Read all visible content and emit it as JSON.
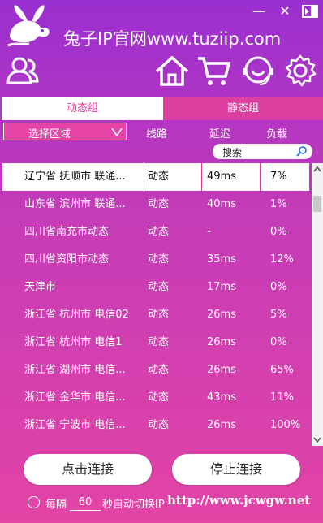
{
  "window": {
    "title": "兔子IP官网www.tuziip.com",
    "minimize_glyph": "—",
    "close_glyph": "✕",
    "pin_icon": "exit-icon"
  },
  "toolbar": {
    "icons": [
      "users-icon",
      "home-icon",
      "cart-icon",
      "support-icon",
      "gear-icon"
    ]
  },
  "tabs": [
    {
      "label": "动态组",
      "active": true
    },
    {
      "label": "静态组",
      "active": false
    }
  ],
  "filter": {
    "region_select": "选择区域",
    "columns": {
      "line": "线路",
      "latency": "延迟",
      "load": "负载"
    },
    "search_placeholder": "搜索"
  },
  "servers": [
    {
      "name": "辽宁省 抚顺市 联通...",
      "line": "动态",
      "latency": "49ms",
      "load": "7%",
      "selected": true
    },
    {
      "name": "山东省 滨州市 联通...",
      "line": "动态",
      "latency": "40ms",
      "load": "1%"
    },
    {
      "name": "四川省南充市动态",
      "line": "动态",
      "latency": "-",
      "load": "0%"
    },
    {
      "name": "四川省资阳市动态",
      "line": "动态",
      "latency": "35ms",
      "load": "12%"
    },
    {
      "name": "天津市",
      "line": "动态",
      "latency": "17ms",
      "load": "0%"
    },
    {
      "name": "浙江省 杭州市 电信02",
      "line": "动态",
      "latency": "26ms",
      "load": "5%"
    },
    {
      "name": "浙江省 杭州市 电信1",
      "line": "动态",
      "latency": "26ms",
      "load": "0%"
    },
    {
      "name": "浙江省 湖州市 电信...",
      "line": "动态",
      "latency": "26ms",
      "load": "65%"
    },
    {
      "name": "浙江省 金华市 电信...",
      "line": "动态",
      "latency": "43ms",
      "load": "11%"
    },
    {
      "name": "浙江省 宁波市 电信...",
      "line": "动态",
      "latency": "26ms",
      "load": "100%"
    }
  ],
  "actions": {
    "connect": "点击连接",
    "stop": "停止连接"
  },
  "auto_switch": {
    "every_label": "每隔",
    "interval": "60",
    "suffix_label": "秒自动切换IP"
  },
  "watermark": "http://www.jcwgw.net",
  "colors": {
    "accent": "#e0379d",
    "header_top": "#9a2fd0",
    "body_bottom": "#e344a6"
  }
}
